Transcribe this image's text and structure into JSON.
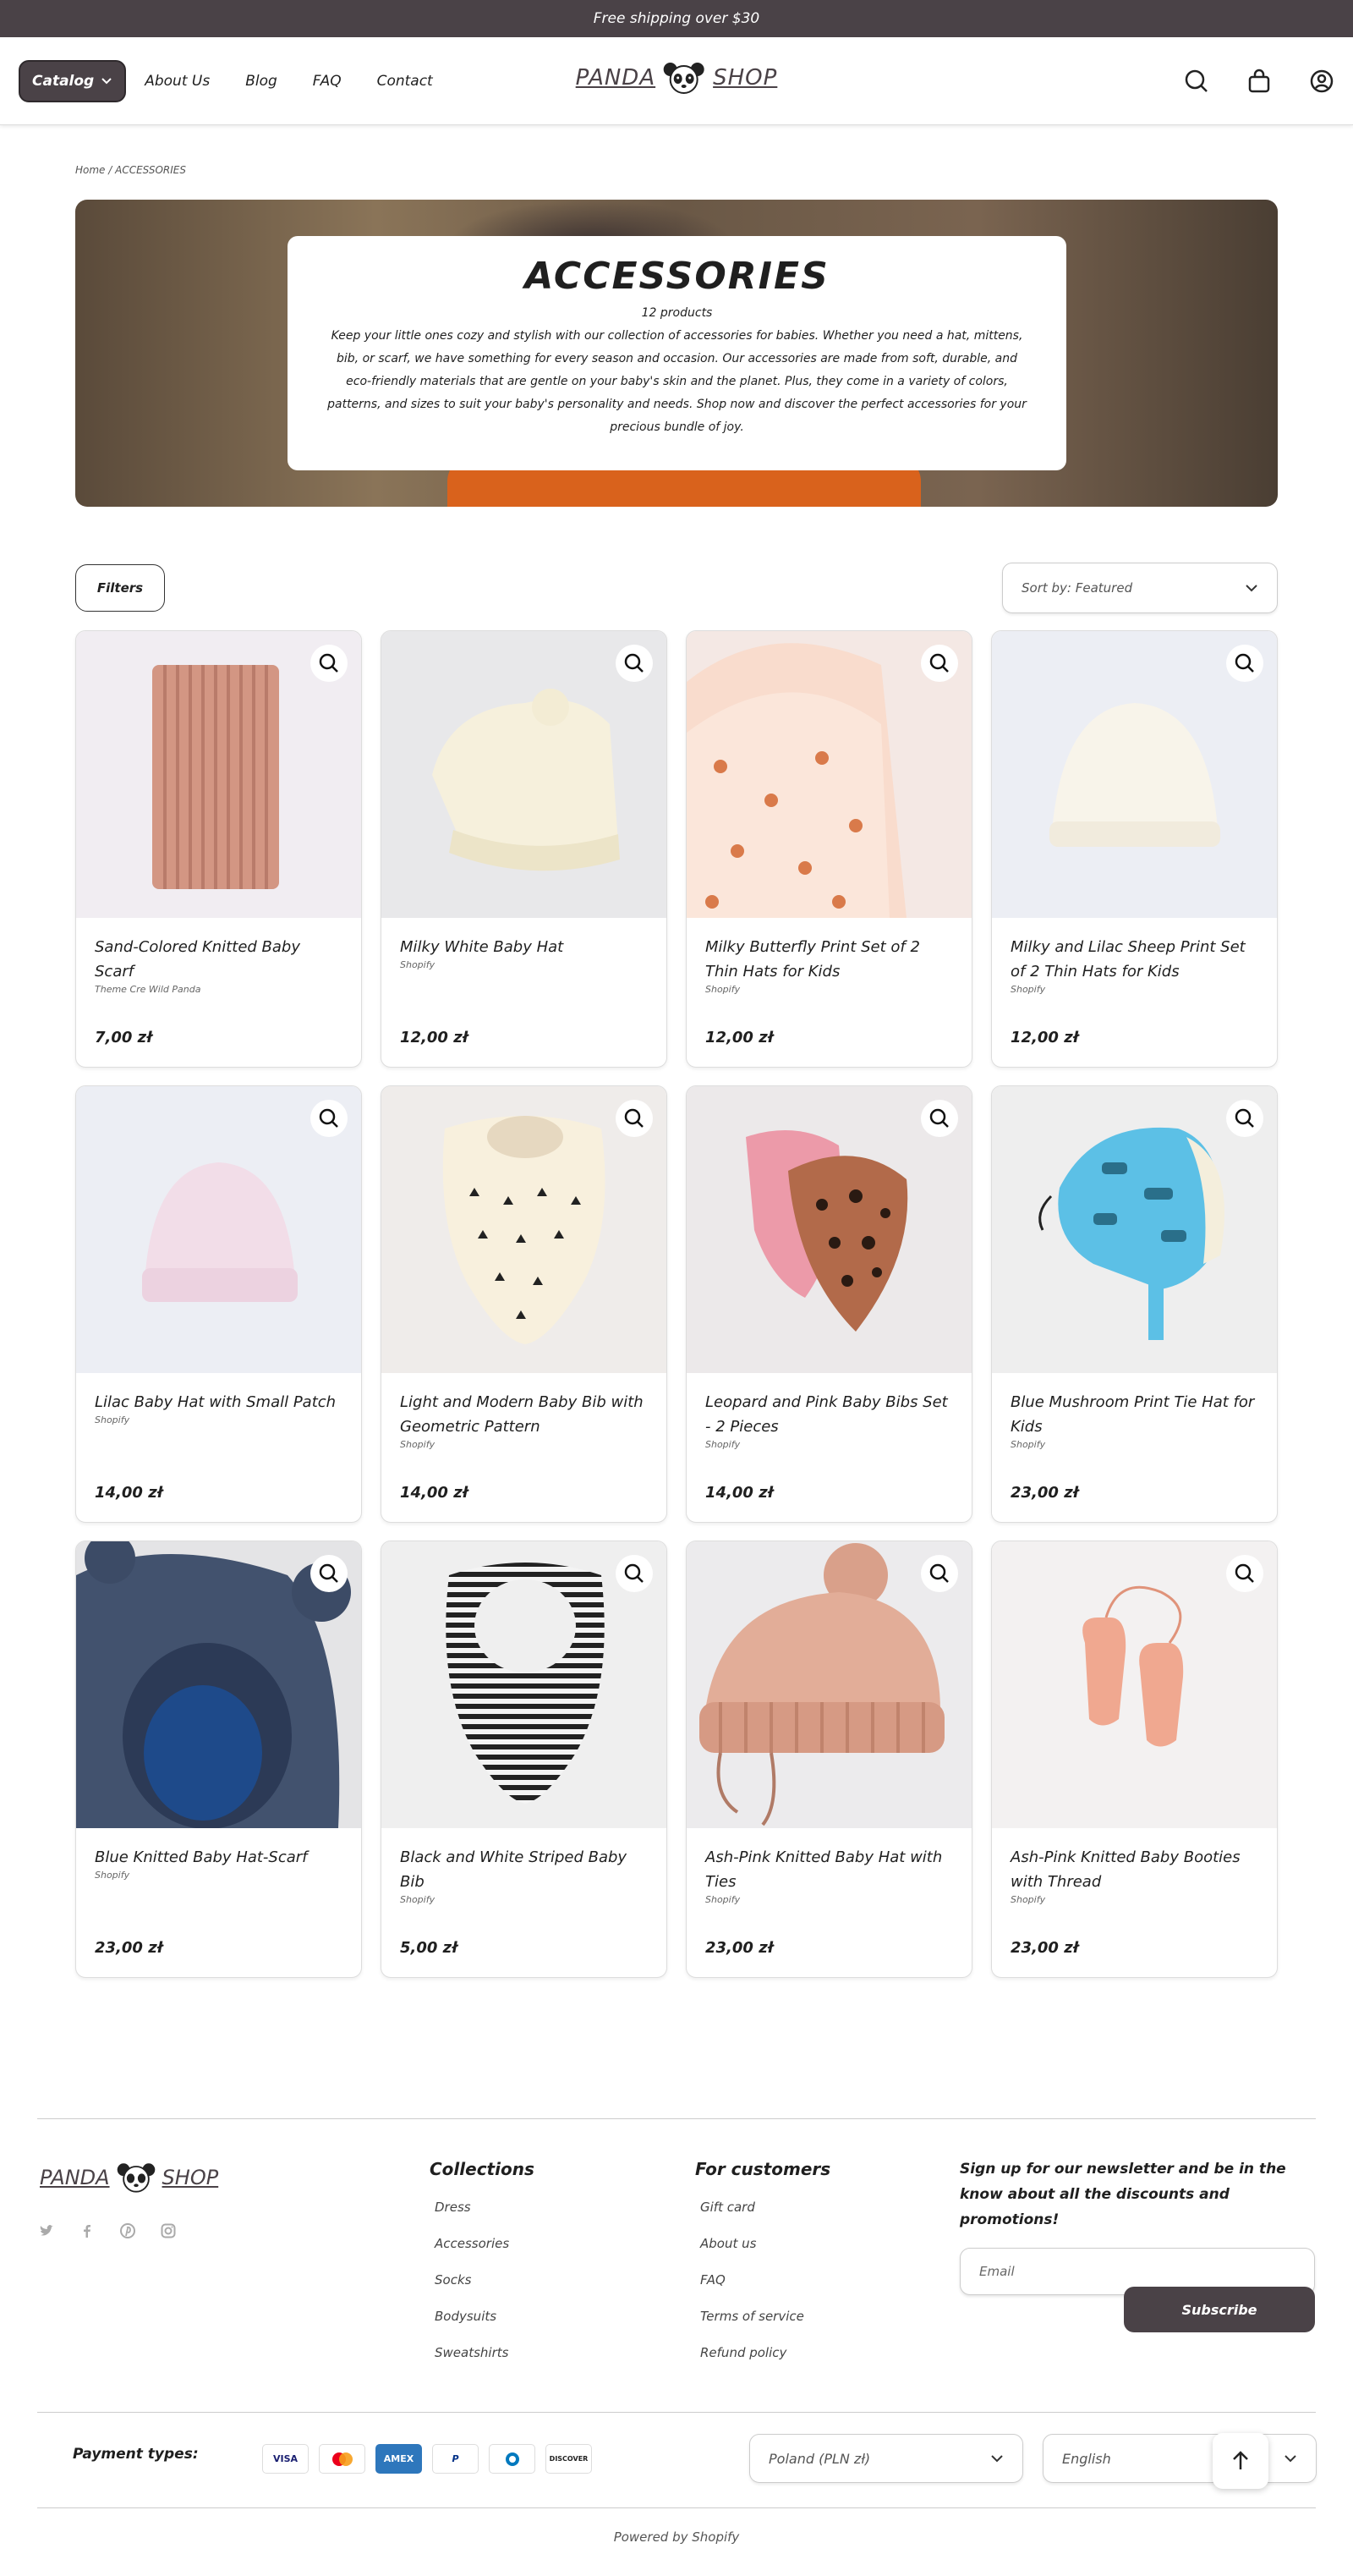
{
  "announcement": "Free shipping over $30",
  "header": {
    "catalog_label": "Catalog",
    "nav": [
      "About Us",
      "Blog",
      "FAQ",
      "Contact"
    ],
    "logo_left": "PANDA",
    "logo_right": "SHOP"
  },
  "breadcrumb": "Home / ACCESSORIES",
  "collection": {
    "title": "ACCESSORIES",
    "count": "12 products",
    "description": "Keep your little ones cozy and stylish with our collection of accessories for babies. Whether you need a hat, mittens, bib, or scarf, we have something for every season and occasion. Our accessories are made from soft, durable, and eco-friendly materials that are gentle on your baby's skin and the planet. Plus, they come in a variety of colors, patterns, and sizes to suit your baby's personality and needs. Shop now and discover the perfect accessories for your precious bundle of joy."
  },
  "toolbar": {
    "filters_label": "Filters",
    "sort_label": "Sort by: Featured"
  },
  "products": [
    {
      "title": "Sand-Colored Knitted Baby Scarf",
      "vendor": "Theme Cre Wild Panda",
      "price": "7,00 zł"
    },
    {
      "title": "Milky White Baby Hat",
      "vendor": "Shopify",
      "price": "12,00 zł"
    },
    {
      "title": "Milky Butterfly Print Set of 2 Thin Hats for Kids",
      "vendor": "Shopify",
      "price": "12,00 zł"
    },
    {
      "title": "Milky and Lilac Sheep Print Set of 2 Thin Hats for Kids",
      "vendor": "Shopify",
      "price": "12,00 zł"
    },
    {
      "title": "Lilac Baby Hat with Small Patch",
      "vendor": "Shopify",
      "price": "14,00 zł"
    },
    {
      "title": "Light and Modern Baby Bib with Geometric Pattern",
      "vendor": "Shopify",
      "price": "14,00 zł"
    },
    {
      "title": "Leopard and Pink Baby Bibs Set - 2 Pieces",
      "vendor": "Shopify",
      "price": "14,00 zł"
    },
    {
      "title": "Blue Mushroom Print Tie Hat for Kids",
      "vendor": "Shopify",
      "price": "23,00 zł"
    },
    {
      "title": "Blue Knitted Baby Hat-Scarf",
      "vendor": "Shopify",
      "price": "23,00 zł"
    },
    {
      "title": "Black and White Striped Baby Bib",
      "vendor": "Shopify",
      "price": "5,00 zł"
    },
    {
      "title": "Ash-Pink Knitted Baby Hat with Ties",
      "vendor": "Shopify",
      "price": "23,00 zł"
    },
    {
      "title": "Ash-Pink Knitted Baby Booties with Thread",
      "vendor": "Shopify",
      "price": "23,00 zł"
    }
  ],
  "footer": {
    "collections_title": "Collections",
    "collections": [
      "Dress",
      "Accessories",
      "Socks",
      "Bodysuits",
      "Sweatshirts"
    ],
    "customers_title": "For customers",
    "customers": [
      "Gift card",
      "About us",
      "FAQ",
      "Terms of service",
      "Refund policy"
    ],
    "newsletter_text": "Sign up for our newsletter and be in the know about all the discounts and promotions!",
    "email_placeholder": "Email",
    "subscribe_label": "Subscribe",
    "payment_label": "Payment types:",
    "payment_methods": [
      "VISA",
      "mastercard",
      "AMEX",
      "PayPal",
      "Diners",
      "DISCOVER"
    ],
    "country": "Poland (PLN zł)",
    "language": "English",
    "powered": "Powered by Shopify"
  },
  "colors": {
    "brand": "#4a4247"
  }
}
